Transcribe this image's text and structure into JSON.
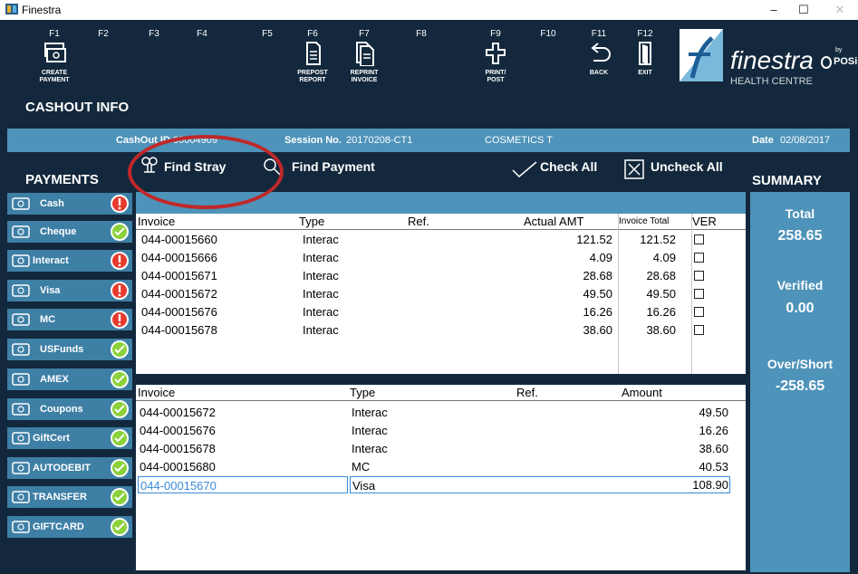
{
  "window": {
    "title": "Finestra"
  },
  "toolbar": {
    "fkeys": [
      "F1",
      "F2",
      "F3",
      "F4",
      "F5",
      "F6",
      "F7",
      "F8",
      "F9",
      "F10",
      "F11",
      "F12"
    ],
    "create_payment": "CREATE\nPAYMENT",
    "prepost_report": "PREPOST\nREPORT",
    "reprint_invoice": "REPRINT\nINVOICE",
    "print_post": "PRINT/\nPOST",
    "back": "BACK",
    "exit": "EXIT"
  },
  "brand": {
    "name": "finestra",
    "sub": "HEALTH CENTRE",
    "partner": "POSi",
    "partner_by": "by"
  },
  "cashout": {
    "title": "CASHOUT INFO",
    "id_label": "CashOut ID",
    "id_value": "00004909",
    "session_label": "Session No.",
    "session_value": "20170208-CT1",
    "department": "COSMETICS T",
    "date_label": "Date",
    "date_value": "02/08/2017"
  },
  "payments": {
    "title": "PAYMENTS",
    "items": [
      {
        "label": "Cash",
        "status": "warn",
        "icon": "cash-icon"
      },
      {
        "label": "Cheque",
        "status": "ok",
        "icon": "cheque-icon"
      },
      {
        "label": "Interact",
        "status": "warn",
        "icon": "card-icon"
      },
      {
        "label": "Visa",
        "status": "warn",
        "icon": "visa-icon"
      },
      {
        "label": "MC",
        "status": "warn",
        "icon": "mastercard-icon"
      },
      {
        "label": "USFunds",
        "status": "ok",
        "icon": "usfunds-icon"
      },
      {
        "label": "AMEX",
        "status": "ok",
        "icon": "amex-icon"
      },
      {
        "label": "Coupons",
        "status": "ok",
        "icon": "coupon-icon"
      },
      {
        "label": "GiftCert",
        "status": "ok",
        "icon": "giftcert-icon"
      },
      {
        "label": "AUTODEBIT",
        "status": "ok",
        "icon": "autodebit-icon"
      },
      {
        "label": "TRANSFER",
        "status": "ok",
        "icon": "transfer-icon"
      },
      {
        "label": "GIFTCARD",
        "status": "ok",
        "icon": "giftcard-icon"
      }
    ]
  },
  "actions": {
    "find_stray": "Find Stray",
    "find_payment": "Find Payment",
    "check_all": "Check All",
    "uncheck_all": "Uncheck All"
  },
  "summary": {
    "title": "SUMMARY",
    "total_label": "Total",
    "total_value": "258.65",
    "verified_label": "Verified",
    "verified_value": "0.00",
    "overshort_label": "Over/Short",
    "overshort_value": "-258.65"
  },
  "upper_grid": {
    "headers": {
      "invoice": "Invoice",
      "type": "Type",
      "ref": "Ref.",
      "actual": "Actual AMT",
      "total": "Invoice Total",
      "ver": "VER"
    },
    "rows": [
      {
        "invoice": "044-00015660",
        "type": "Interac",
        "actual": "121.52",
        "total": "121.52"
      },
      {
        "invoice": "044-00015666",
        "type": "Interac",
        "actual": "4.09",
        "total": "4.09"
      },
      {
        "invoice": "044-00015671",
        "type": "Interac",
        "actual": "28.68",
        "total": "28.68"
      },
      {
        "invoice": "044-00015672",
        "type": "Interac",
        "actual": "49.50",
        "total": "49.50"
      },
      {
        "invoice": "044-00015676",
        "type": "Interac",
        "actual": "16.26",
        "total": "16.26"
      },
      {
        "invoice": "044-00015678",
        "type": "Interac",
        "actual": "38.60",
        "total": "38.60"
      }
    ]
  },
  "lower_grid": {
    "headers": {
      "invoice": "Invoice",
      "type": "Type",
      "ref": "Ref.",
      "amount": "Amount"
    },
    "rows": [
      {
        "invoice": "044-00015672",
        "type": "Interac",
        "amount": "49.50"
      },
      {
        "invoice": "044-00015676",
        "type": "Interac",
        "amount": "16.26"
      },
      {
        "invoice": "044-00015678",
        "type": "Interac",
        "amount": "38.60"
      },
      {
        "invoice": "044-00015680",
        "type": "MC",
        "amount": "40.53"
      },
      {
        "invoice": "044-00015670",
        "type": "Visa",
        "amount": "108.90"
      }
    ]
  },
  "colors": {
    "dark": "#13283c",
    "accent": "#4e93b9",
    "button": "#3e7fa5",
    "warn": "#e53a2c",
    "ok": "#8bd13a",
    "highlight": "#c0282a"
  }
}
